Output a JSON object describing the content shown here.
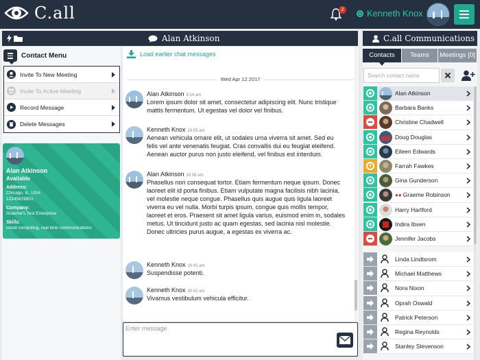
{
  "app": {
    "logo_text": "C.all",
    "notifications_count": "2",
    "user_name": "Kenneth Knox"
  },
  "headers": {
    "chat_title": "Alan Atkinson",
    "right_title": "C.all Communications"
  },
  "contact_menu": {
    "title": "Contact Menu",
    "items": [
      {
        "label": "Invite To New Meeting",
        "icon": "user-icon",
        "disabled": false
      },
      {
        "label": "Invite To Active Meeting",
        "icon": "group-icon",
        "disabled": true
      },
      {
        "label": "Record Message",
        "icon": "play-icon",
        "disabled": false
      },
      {
        "label": "Delete Messages",
        "icon": "trash-icon",
        "disabled": false
      }
    ]
  },
  "contact_card": {
    "name": "Alan Atkinson",
    "status": "Available",
    "address_label": "Address:",
    "address_line1": "Chicago, IL, USA",
    "address_line2": "12345678901",
    "company_label": "Company:",
    "company": "Graeme's Test Enterprise",
    "skills_label": "Skills:",
    "skills": "cloud computing, real time communications"
  },
  "chat": {
    "load_earlier": "Load earlier chat messages",
    "date": "Wed Apr 12 2017",
    "messages": [
      {
        "author": "Alan Atkinson",
        "time": "9:14 am",
        "text": "Lorem ipsum dolor sit amet, consectetur adipiscing elit. Nunc tristique mattis fermentum. Ut egestas vel dolor vel finibus."
      },
      {
        "author": "Kenneth Knox",
        "time": "10:05 am",
        "text": "Aenean vehicula ornare elit, ut sodales urna viverra sit amet. Sed eu felis vel ante venenatis feugiat. Cras convallis dui eu feugiat eleifend. Aenean auctor purus non justo eleifend, vel finibus est interdum."
      },
      {
        "author": "Alan Atkinson",
        "time": "10:06 am",
        "text": "Phasellus non consequat tortor. Etiam fermentum neque ipsum. Donec laoreet elit id porta finibus. Etiam vulputate magna facilisis nibh lacinia, vel molestie neque congue. Phasellus quis augue quis ligula laoreet viverra eu vel nulla. Morbi turpis ipsum, congue quis mollis tempor, laoreet et eros. Praesent sit amet ligula varius, euismod enim in, sodales metus. Ut tincidunt justo ac quam egestas, sed lacinia nisl molestie. Donec ultricies purus augue, a egestas ex viverra ac."
      },
      {
        "author": "Kenneth Knox",
        "time": "10:42 am",
        "text": "Suspendisse potenti."
      },
      {
        "author": "Kenneth Knox",
        "time": "10:42 am",
        "text": "Vivamus vestibulum vehicula efficitur."
      }
    ],
    "composer_placeholder": "Enter message"
  },
  "right_panel": {
    "tabs": [
      {
        "label": "Contacts",
        "active": true
      },
      {
        "label": "Teams",
        "active": false
      },
      {
        "label": "Meetings [0]",
        "active": false
      }
    ],
    "search_placeholder": "Search contact name",
    "contacts_online": [
      {
        "name": "Alan Atkinson",
        "status": "green",
        "selected": true,
        "chat": false
      },
      {
        "name": "Barbara Banks",
        "status": "green",
        "selected": false,
        "chat": false
      },
      {
        "name": "Christine Chadwell",
        "status": "red",
        "selected": false,
        "chat": false
      },
      {
        "name": "Doug Douglas",
        "status": "green",
        "selected": false,
        "chat": false
      },
      {
        "name": "Eileen Edwards",
        "status": "green",
        "selected": false,
        "chat": false
      },
      {
        "name": "Farrah Fawkes",
        "status": "yellow",
        "selected": false,
        "chat": false
      },
      {
        "name": "Gina Gunderson",
        "status": "green",
        "selected": false,
        "chat": false
      },
      {
        "name": "Graeme Robinson",
        "status": "green",
        "selected": false,
        "chat": true
      },
      {
        "name": "Harry Hartford",
        "status": "green",
        "selected": false,
        "chat": false
      },
      {
        "name": "Indira Ibsen",
        "status": "green",
        "selected": false,
        "chat": false
      },
      {
        "name": "Jennifer Jacobs",
        "status": "red",
        "selected": false,
        "chat": false
      }
    ],
    "contacts_offline": [
      {
        "name": "Linda Lindtsrom"
      },
      {
        "name": "Michael Matthews"
      },
      {
        "name": "Nora Nixon"
      },
      {
        "name": "Oprah Oswald"
      },
      {
        "name": "Patrick Peterson"
      },
      {
        "name": "Regina Reynolds"
      },
      {
        "name": "Stanley Stevenson"
      }
    ]
  }
}
